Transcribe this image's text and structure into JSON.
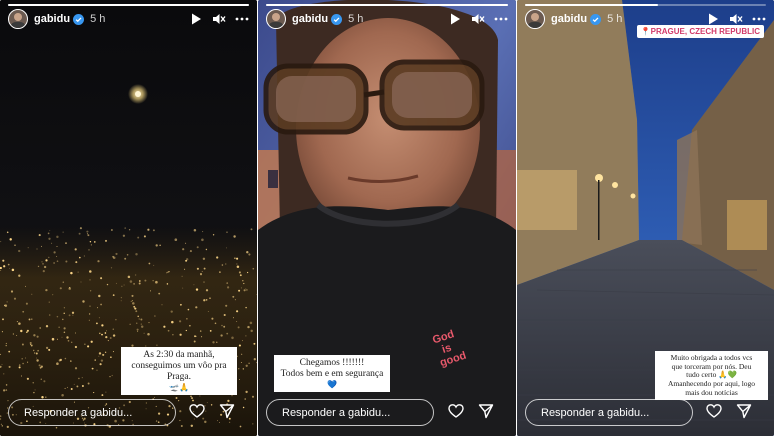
{
  "stories": [
    {
      "progress": 1,
      "username": "gabidu",
      "time": "5 h",
      "caption": {
        "line1": "As 2:30 da manhã,",
        "line2": "conseguimos um vôo pra",
        "line3": "Praga.",
        "emoji": "🛫🙏"
      },
      "reply_placeholder": "Responder a gabidu..."
    },
    {
      "progress": 1,
      "username": "gabidu",
      "time": "5 h",
      "caption": {
        "line1": "Chegamos !!!!!!!",
        "line2": "Todos bem e em segurança",
        "emoji": "💙"
      },
      "shirt_text": [
        "God",
        "is",
        "good"
      ],
      "reply_placeholder": "Responder a gabidu..."
    },
    {
      "progress": 0.55,
      "username": "gabidu",
      "time": "5 h",
      "location": "📍PRAGUE, CZECH REPUBLIC",
      "caption": {
        "line1": "Muito obrigada a todos vcs",
        "line2": "que torceram por nós. Deu",
        "line3": "tudo certo 🙏💚",
        "line4": "Amanhecendo por aqui, logo",
        "line5": "mais dou notícias"
      },
      "reply_placeholder": "Responder a gabidu..."
    }
  ],
  "icons": {
    "play": "play-icon",
    "mute": "mute-icon",
    "more": "more-icon",
    "like": "heart-icon",
    "share": "send-icon",
    "verified": "verified-badge-icon"
  },
  "colors": {
    "verified": "#3897f0",
    "location_text": "#d33b6a",
    "shirt_text": "#e8596b"
  }
}
